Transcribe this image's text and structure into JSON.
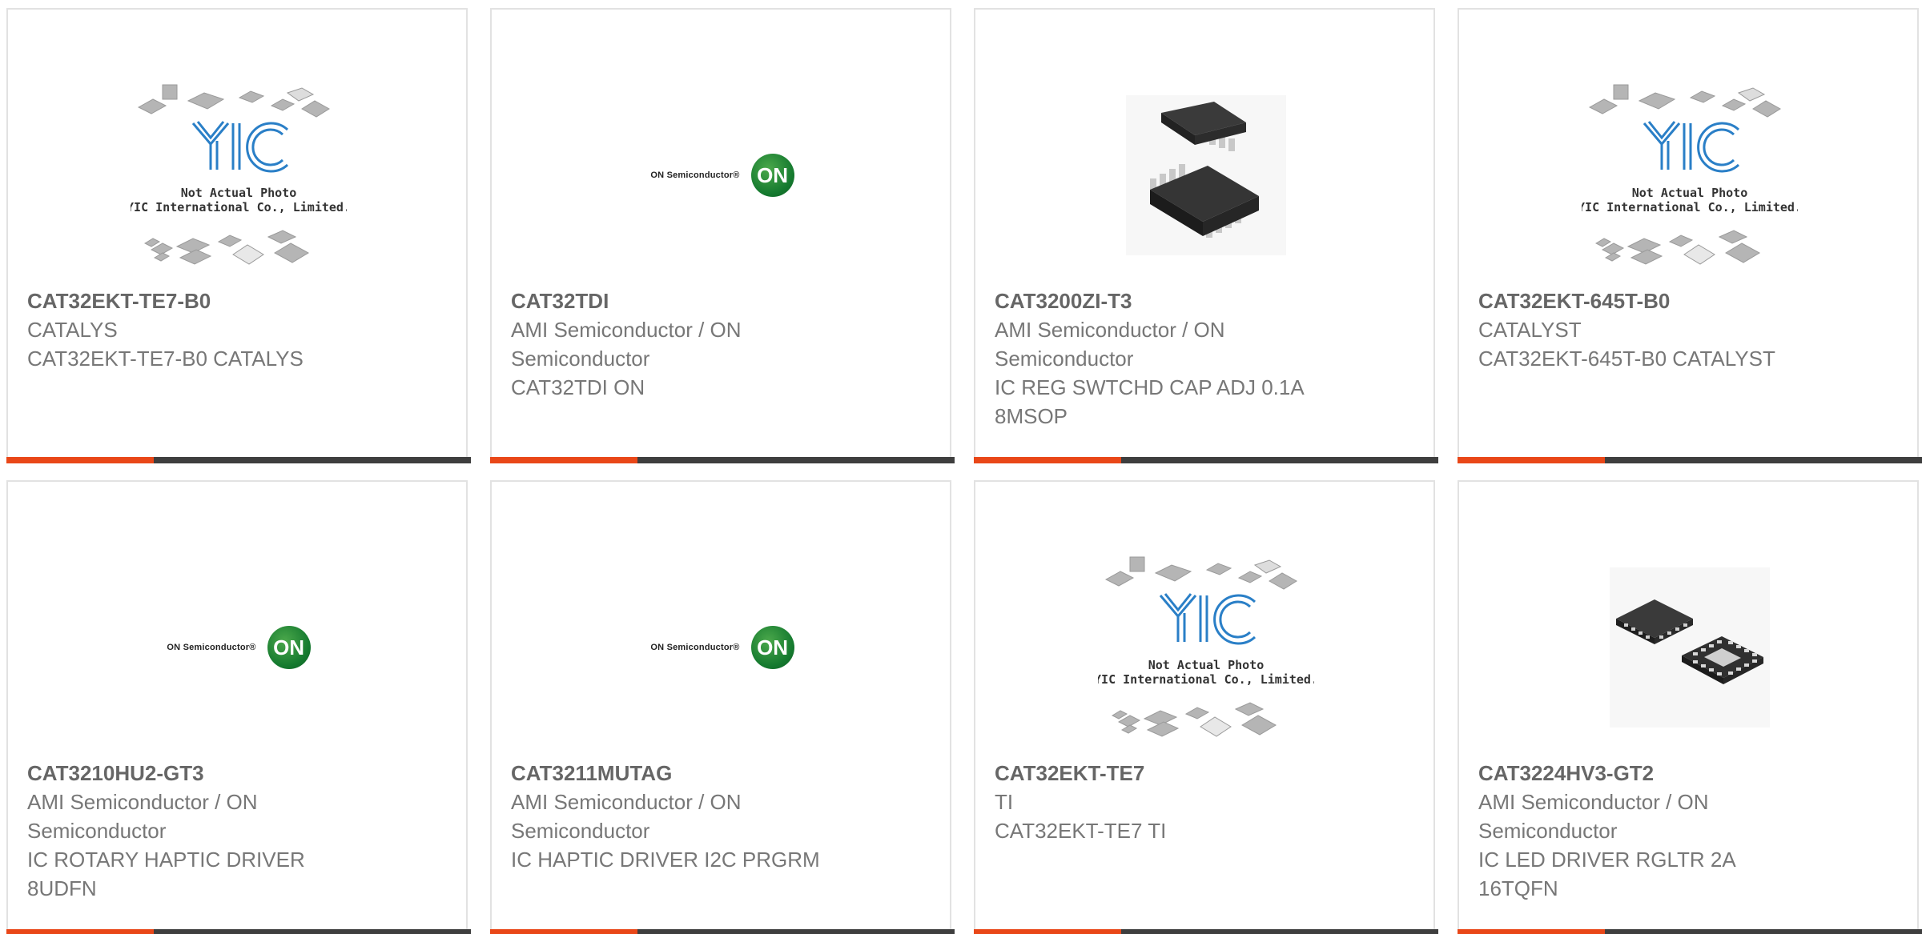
{
  "products": [
    {
      "part": "CAT32EKT-TE7-B0",
      "manufacturer": "CATALYS",
      "description": "CAT32EKT-TE7-B0 CATALYS",
      "image": "yic-not-actual-photo",
      "image_caption": [
        "Not Actual Photo",
        "YIC International Co., Limited."
      ]
    },
    {
      "part": "CAT32TDI",
      "manufacturer": "AMI Semiconductor / ON Semiconductor",
      "description": "CAT32TDI ON",
      "image": "on-semiconductor-logo",
      "logo_text": "ON Semiconductor®",
      "logo_mark": "ON"
    },
    {
      "part": "CAT3200ZI-T3",
      "manufacturer": "AMI Semiconductor / ON Semiconductor",
      "description": "IC REG SWTCHD CAP ADJ 0.1A 8MSOP",
      "image": "msop8-package-photo"
    },
    {
      "part": "CAT32EKT-645T-B0",
      "manufacturer": "CATALYST",
      "description": "CAT32EKT-645T-B0 CATALYST",
      "image": "yic-not-actual-photo",
      "image_caption": [
        "Not Actual Photo",
        "YIC International Co., Limited."
      ]
    },
    {
      "part": "CAT3210HU2-GT3",
      "manufacturer": "AMI Semiconductor / ON Semiconductor",
      "description": "IC ROTARY HAPTIC DRIVER 8UDFN",
      "image": "on-semiconductor-logo",
      "logo_text": "ON Semiconductor®",
      "logo_mark": "ON"
    },
    {
      "part": "CAT3211MUTAG",
      "manufacturer": "AMI Semiconductor / ON Semiconductor",
      "description": "IC HAPTIC DRIVER I2C PRGRM",
      "image": "on-semiconductor-logo",
      "logo_text": "ON Semiconductor®",
      "logo_mark": "ON"
    },
    {
      "part": "CAT32EKT-TE7",
      "manufacturer": "TI",
      "description": "CAT32EKT-TE7 TI",
      "image": "yic-not-actual-photo",
      "image_caption": [
        "Not Actual Photo",
        "YIC International Co., Limited."
      ]
    },
    {
      "part": "CAT3224HV3-GT2",
      "manufacturer": "AMI Semiconductor / ON Semiconductor",
      "description": "IC LED DRIVER RGLTR 2A 16TQFN",
      "image": "tqfn16-package-photo"
    }
  ],
  "colors": {
    "accent": "#e94718",
    "bar": "#3e3e3e",
    "text": "#777777",
    "part_text": "#666666",
    "border": "#e2e2e2"
  }
}
